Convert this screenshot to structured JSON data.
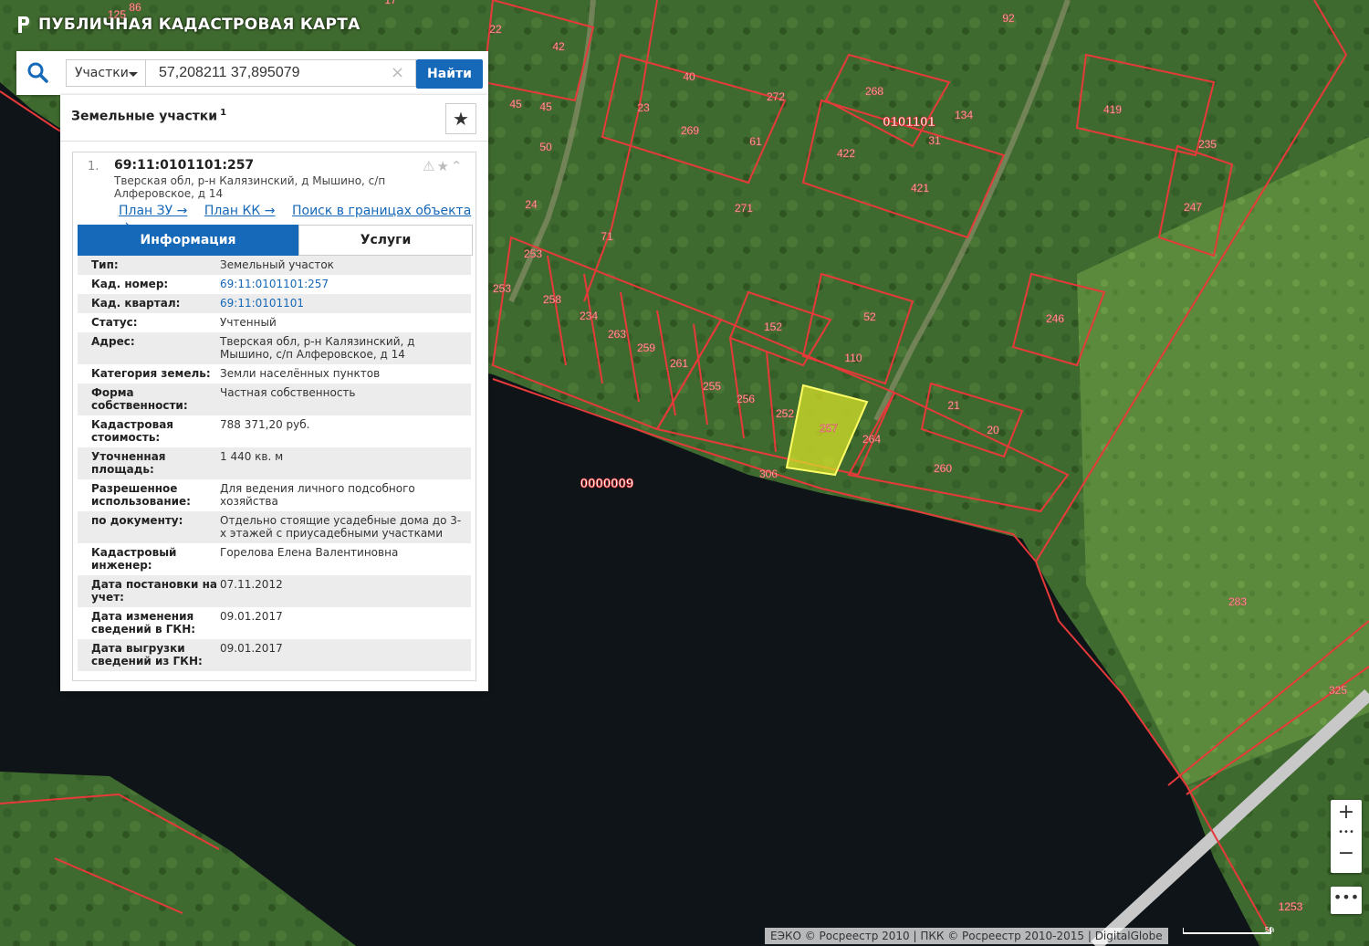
{
  "header": {
    "app_title": "ПУБЛИЧНАЯ КАДАСТРОВАЯ КАРТА"
  },
  "search": {
    "type_label": "Участки",
    "query": "57,208211 37,895079",
    "find_label": "Найти"
  },
  "panel": {
    "title": "Земельные участки",
    "count": "1",
    "result": {
      "number": "1.",
      "cad_number": "69:11:0101101:257",
      "address": "Тверская обл, р-н Калязинский, д Мышино, с/п Алферовское, д 14",
      "links": [
        "План ЗУ →",
        "План КК →",
        "Поиск в границах объекта →"
      ]
    },
    "tabs": [
      "Информация",
      "Услуги"
    ],
    "rows": [
      {
        "label": "Тип:",
        "value": "Земельный участок"
      },
      {
        "label": "Кад. номер:",
        "value": "69:11:0101101:257",
        "link": true
      },
      {
        "label": "Кад. квартал:",
        "value": "69:11:0101101",
        "link": true
      },
      {
        "label": "Статус:",
        "value": "Учтенный"
      },
      {
        "label": "Адрес:",
        "value": "Тверская обл, р-н Калязинский, д Мышино, с/п Алферовское, д 14"
      },
      {
        "label": "Категория земель:",
        "value": "Земли населённых пунктов"
      },
      {
        "label": "Форма собственности:",
        "value": "Частная собственность"
      },
      {
        "label": "Кадастровая стоимость:",
        "value": "788 371,20 руб."
      },
      {
        "label": "Уточненная площадь:",
        "value": "1 440 кв. м"
      },
      {
        "label": "Разрешенное использование:",
        "value": "Для ведения личного подсобного хозяйства"
      },
      {
        "label": "по документу:",
        "value": "Отдельно стоящие усадебные дома до 3-х этажей с приусадебными участками"
      },
      {
        "label": "Кадастровый инженер:",
        "value": "Горелова Елена Валентиновна"
      },
      {
        "label": "Дата постановки на учет:",
        "value": "07.11.2012"
      },
      {
        "label": "Дата изменения сведений в ГКН:",
        "value": "09.01.2017"
      },
      {
        "label": "Дата выгрузки сведений из ГКН:",
        "value": "09.01.2017"
      }
    ]
  },
  "map": {
    "parcel_labels": [
      "86",
      "125",
      "17",
      "22",
      "42",
      "92",
      "45",
      "40",
      "272",
      "268",
      "134",
      "419",
      "45",
      "23",
      "269",
      "61",
      "0101101",
      "31",
      "235",
      "50",
      "422",
      "421",
      "247",
      "24",
      "271",
      "71",
      "253",
      "258",
      "253",
      "234",
      "263",
      "259",
      "261",
      "255",
      "256",
      "252",
      "257",
      "264",
      "152",
      "52",
      "110",
      "246",
      "21",
      "20",
      "306",
      "260",
      "0000009",
      "283",
      "325",
      "1253"
    ],
    "selected_parcel": "257",
    "colors": {
      "boundary": "#e63a3a",
      "selected_fill": "#d7e02a",
      "water": "#0e1418"
    }
  },
  "controls": {
    "zoom_in": "+",
    "zoom_dots": "•••",
    "zoom_out": "−",
    "more": "•••"
  },
  "footer": {
    "attribution": "ЕЭКО © Росреестр 2010 | ПКК © Росреестр 2010-2015 | DigitalGlobe",
    "scale": "50m"
  }
}
